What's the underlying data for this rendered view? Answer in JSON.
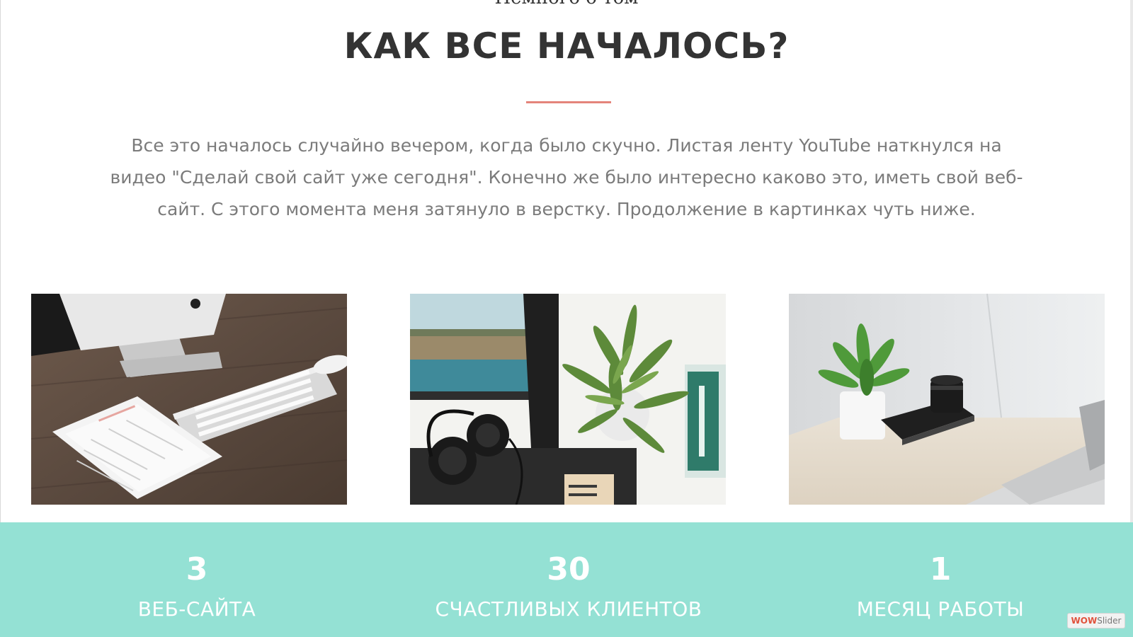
{
  "section": {
    "kicker": "Немного о том",
    "title": "КАК ВСЕ НАЧАЛОСЬ?",
    "lead_line_1": "Все это началось случайно вечером, когда было скучно. Листая ленту YouTube наткнулся на",
    "lead_line_2": "видео \"Сделай свой сайт уже сегодня\". Конечно же было интересно каково это, иметь свой веб-",
    "lead_line_3": "сайт. С этого момента меня затянуло в верстку. Продолжение в картинках чуть ниже."
  },
  "gallery": [
    {
      "name": "workspace-imac-keyboard-tablet"
    },
    {
      "name": "workspace-plant-headphones-notebook"
    },
    {
      "name": "workspace-plant-camera-laptop"
    }
  ],
  "stats": [
    {
      "value": "3",
      "label": "ВЕБ-САЙТА"
    },
    {
      "value": "30",
      "label": "СЧАСТЛИВЫХ КЛИЕНТОВ"
    },
    {
      "value": "1",
      "label": "МЕСЯЦ РАБОТЫ"
    }
  ],
  "badge": {
    "brand": "WOW",
    "suffix": "Slider"
  },
  "colors": {
    "accent_divider": "#e4847a",
    "stats_background": "#94e1d4",
    "title": "#333333",
    "body_text": "#7b7b7b"
  }
}
